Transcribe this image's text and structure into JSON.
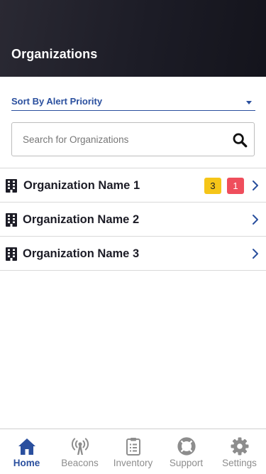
{
  "header": {
    "title": "Organizations"
  },
  "sort": {
    "selected": "Sort By Alert Priority"
  },
  "search": {
    "placeholder": "Search for Organizations",
    "value": ""
  },
  "organizations": [
    {
      "name": "Organization Name 1",
      "badges": {
        "warning": "3",
        "critical": "1"
      }
    },
    {
      "name": "Organization Name 2"
    },
    {
      "name": "Organization Name 3"
    }
  ],
  "tabs": [
    {
      "label": "Home",
      "icon": "home-icon",
      "active": true
    },
    {
      "label": "Beacons",
      "icon": "broadcast-tower-icon",
      "active": false
    },
    {
      "label": "Inventory",
      "icon": "clipboard-list-icon",
      "active": false
    },
    {
      "label": "Support",
      "icon": "life-ring-icon",
      "active": false
    },
    {
      "label": "Settings",
      "icon": "gear-icon",
      "active": false
    }
  ],
  "colors": {
    "header_bg": "#1c1c26",
    "accent": "#2a4f9e",
    "warning": "#f5c518",
    "critical": "#ef4e5c",
    "inactive": "#8d8d8d"
  }
}
